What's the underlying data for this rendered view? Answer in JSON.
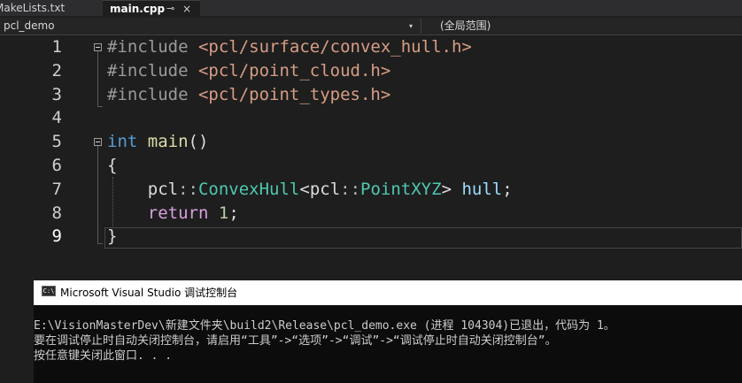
{
  "tabs": {
    "inactive_label": "MakeLists.txt",
    "active_label": "main.cpp",
    "pin_glyph": "⊸",
    "close_glyph": "×"
  },
  "navbar": {
    "project": "pcl_demo",
    "arrow": "▾",
    "scope": "(全局范围)"
  },
  "editor": {
    "line_numbers": [
      "1",
      "2",
      "3",
      "4",
      "5",
      "6",
      "7",
      "8",
      "9"
    ],
    "current_line": "9",
    "code": {
      "l1_directive": "#include",
      "l1_path": "<pcl/surface/convex_hull.h>",
      "l2_directive": "#include",
      "l2_path": "<pcl/point_cloud.h>",
      "l3_directive": "#include",
      "l3_path": "<pcl/point_types.h>",
      "l5_type": "int",
      "l5_func": "main",
      "l5_parens": "()",
      "l6_brace": "{",
      "l7_ns1": "pcl",
      "l7_sep1": "::",
      "l7_class": "ConvexHull",
      "l7_lt": "<",
      "l7_ns2": "pcl",
      "l7_sep2": "::",
      "l7_tparam": "PointXYZ",
      "l7_gt": ">",
      "l7_var": "hull",
      "l7_semi": ";",
      "l8_kw": "return",
      "l8_num": "1",
      "l8_semi": ";",
      "l9_brace": "}"
    },
    "colors": {
      "keyword": "#569cd6",
      "type": "#4ec9b0",
      "function": "#dcdcaa",
      "string": "#d69d85",
      "number": "#b5cea8",
      "control": "#d8a0df"
    }
  },
  "console": {
    "icon_text": "C:\\",
    "title": "Microsoft Visual Studio 调试控制台",
    "lines": [
      "E:\\VisionMasterDev\\新建文件夹\\build2\\Release\\pcl_demo.exe (进程 104304)已退出，代码为 1。",
      "要在调试停止时自动关闭控制台，请启用“工具”->“选项”->“调试”->“调试停止时自动关闭控制台”。",
      "按任意键关闭此窗口. . ."
    ]
  }
}
